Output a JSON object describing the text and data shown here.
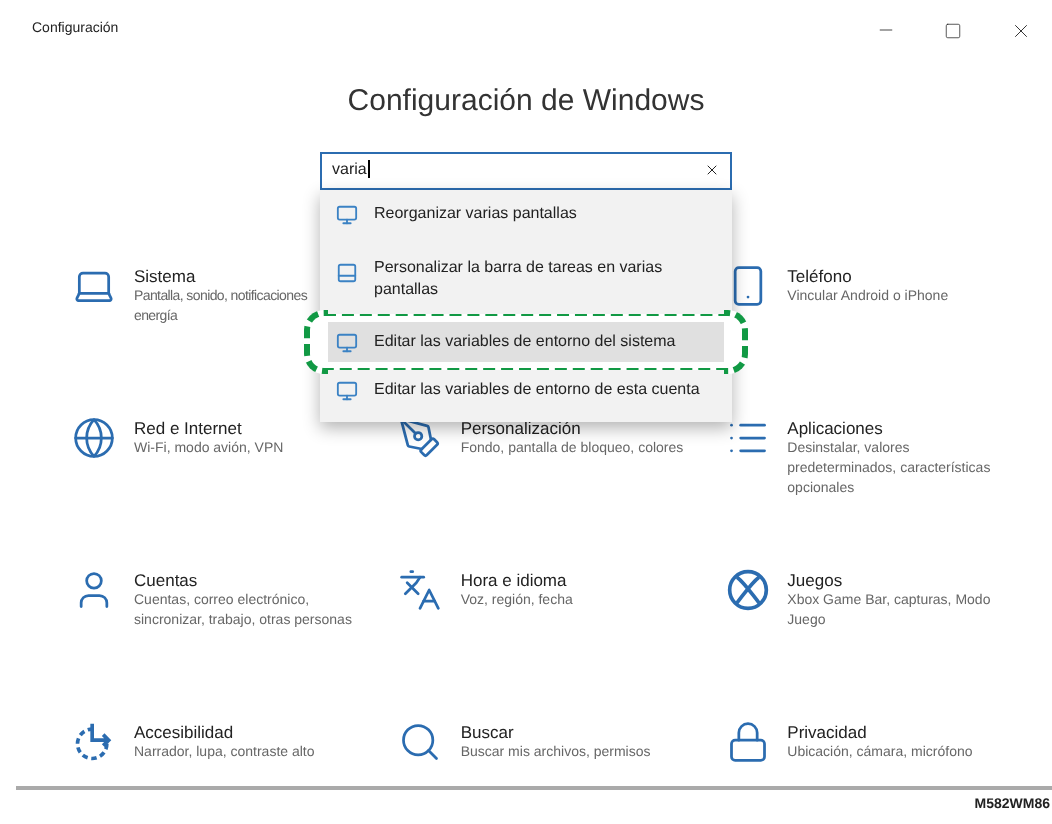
{
  "window": {
    "title": "Configuración"
  },
  "heading": "Configuración de Windows",
  "search": {
    "value": "varia"
  },
  "suggestions": [
    {
      "label": "Reorganizar varias pantallas",
      "selected": false,
      "outlined": false
    },
    {
      "label": "Personalizar la barra de tareas en varias pantallas",
      "selected": false,
      "outlined": false
    },
    {
      "label": "Editar las variables de entorno del sistema",
      "selected": true,
      "outlined": true
    },
    {
      "label": "Editar las variables de entorno de esta cuenta",
      "selected": false,
      "outlined": false
    }
  ],
  "categories": [
    {
      "title": "Sistema",
      "description": "Pantalla, sonido, notificaciones energía"
    },
    {
      "title": "Teléfono",
      "description": "Vincular Android o iPhone"
    },
    {
      "title": "Red e Internet",
      "description": "Wi-Fi, modo avión, VPN"
    },
    {
      "title": "Personalización",
      "description": "Fondo, pantalla de bloqueo, colores"
    },
    {
      "title": "Aplicaciones",
      "description": "Desinstalar, valores predeterminados, características opcionales"
    },
    {
      "title": "Cuentas",
      "description": "Cuentas, correo electrónico, sincronizar, trabajo, otras personas"
    },
    {
      "title": "Hora e idioma",
      "description": "Voz, región, fecha"
    },
    {
      "title": "Juegos",
      "description": "Xbox Game Bar, capturas, Modo Juego"
    },
    {
      "title": "Accesibilidad",
      "description": "Narrador, lupa, contraste alto"
    },
    {
      "title": "Buscar",
      "description": "Buscar mis archivos, permisos"
    },
    {
      "title": "Privacidad",
      "description": "Ubicación, cámara, micrófono"
    }
  ],
  "figure_code": "M582WM86"
}
